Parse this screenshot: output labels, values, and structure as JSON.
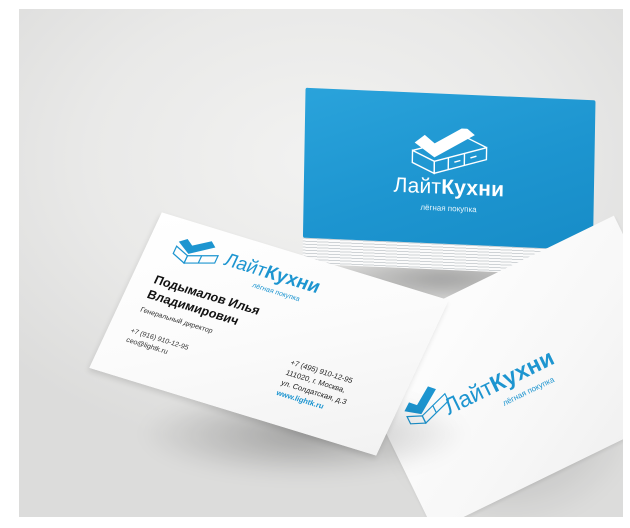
{
  "colors": {
    "brand_blue": "#1d95d0",
    "background": "#e9e9e8",
    "card_white": "#ffffff"
  },
  "blue_card": {
    "brand_light": "Лайт",
    "brand_bold": "Кухни",
    "tagline": "лёгная покупка"
  },
  "front_card": {
    "brand_light": "Лайт",
    "brand_bold": "Кухни",
    "tagline": "лёгная покупка",
    "person_name_line1": "Подымалов Илья",
    "person_name_line2": "Владимирович",
    "person_role": "Генеральный директор",
    "person_phone": "+7 (916) 910-12-95",
    "person_email": "ceo@lightk.ru",
    "company_phone": "+7 (495) 910-12-95",
    "company_address_line1": "111020, г. Москва,",
    "company_address_line2": "ул. Солдатская, д.3",
    "company_website": "www.lightk.ru"
  },
  "back_card": {
    "brand_light": "Лайт",
    "brand_bold": "Кухни",
    "tagline": "лёгная покупка"
  }
}
